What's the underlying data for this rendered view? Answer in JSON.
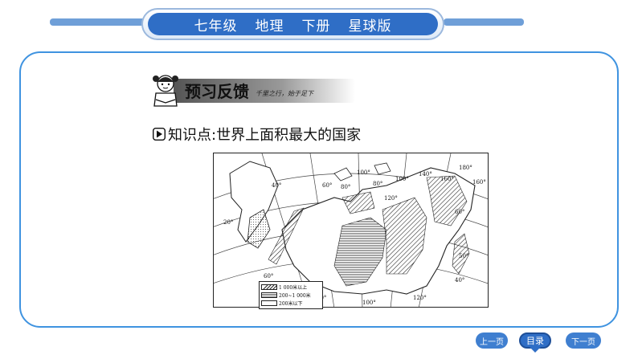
{
  "header": {
    "items": [
      "七年级",
      "地理",
      "下册",
      "星球版"
    ]
  },
  "banner": {
    "title": "预习反馈",
    "motto": "千里之行，始于足下"
  },
  "section": {
    "bullet_icon": "play-triangle-icon",
    "heading": "知识点:世界上面积最大的国家"
  },
  "map": {
    "longitude_labels": [
      "100°",
      "80°",
      "60°",
      "40°",
      "80°",
      "100°",
      "120°",
      "140°",
      "160°",
      "180°",
      "160°",
      "60°",
      "50°",
      "40°",
      "120°",
      "100°",
      "80°",
      "20°",
      "60°"
    ],
    "legend": [
      {
        "label": "1 000米以上",
        "pattern": "hatched"
      },
      {
        "label": "200~1 000米",
        "pattern": "striped"
      },
      {
        "label": "200米以下",
        "pattern": "blank"
      }
    ]
  },
  "footer": {
    "prev": "上一页",
    "toc": "目录",
    "next": "下一页"
  },
  "colors": {
    "primary": "#2f6ec6",
    "border": "#3f93e0",
    "bar": "#6f9fd8"
  }
}
